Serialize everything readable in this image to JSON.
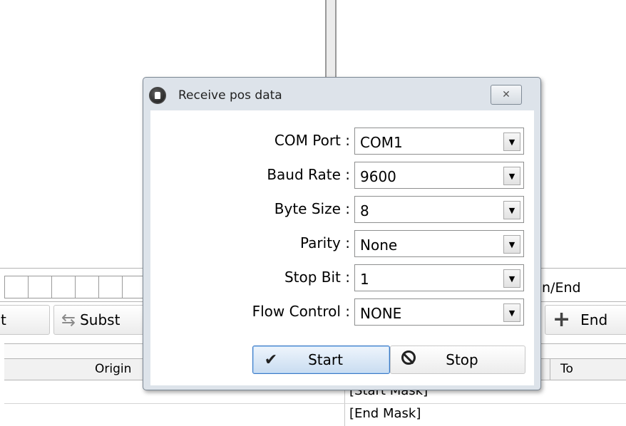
{
  "background": {
    "strip_label": "n/End",
    "toolbar": {
      "left_button_label": "t",
      "subst_button_label": "Subst",
      "end_button_label": "End"
    },
    "table": {
      "header_original": "Origin",
      "header_to": "To",
      "rows": [
        "[Start Mask]",
        "[End Mask]"
      ]
    }
  },
  "dialog": {
    "title": "Receive pos data",
    "close_glyph": "✕",
    "fields": [
      {
        "label": "COM Port :",
        "value": "COM1"
      },
      {
        "label": "Baud Rate :",
        "value": "9600"
      },
      {
        "label": "Byte Size :",
        "value": "8"
      },
      {
        "label": "Parity :",
        "value": "None"
      },
      {
        "label": "Stop Bit :",
        "value": "1"
      },
      {
        "label": "Flow Control :",
        "value": "NONE"
      }
    ],
    "start_label": "Start",
    "stop_label": "Stop"
  },
  "icons": {
    "check": "check-icon",
    "stop": "stop-icon",
    "dropdown": "chevron-down-icon",
    "swap": "swap-icon",
    "plus": "plus-icon"
  }
}
